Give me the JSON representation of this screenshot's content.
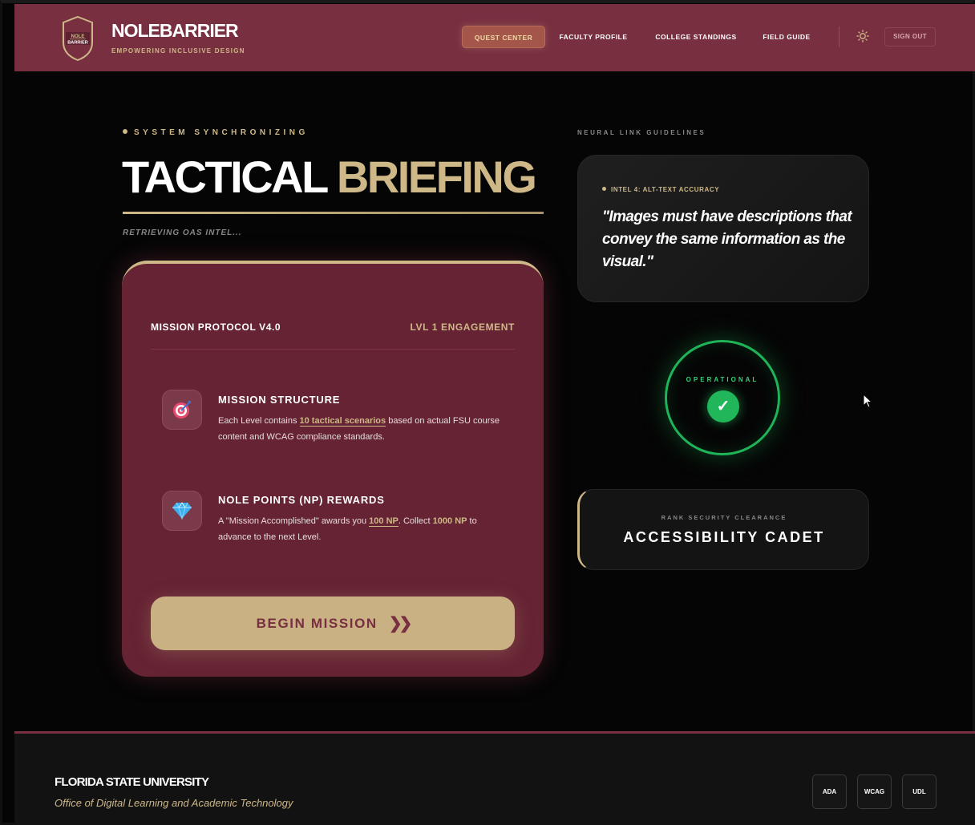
{
  "header": {
    "logo_lines": [
      "NOLE",
      "BARRIER"
    ],
    "title": "NOLEBARRIER",
    "subtitle": "EMPOWERING INCLUSIVE DESIGN",
    "nav": [
      {
        "label": "QUEST CENTER",
        "active": true
      },
      {
        "label": "FACULTY PROFILE",
        "active": false
      },
      {
        "label": "COLLEGE STANDINGS",
        "active": false
      },
      {
        "label": "FIELD GUIDE",
        "active": false
      }
    ],
    "theme_icon": "sun-icon",
    "signout_label": "SIGN OUT"
  },
  "main": {
    "status_line": "SYSTEM SYNCHRONIZING",
    "hero_word1": "TACTICAL",
    "hero_word2": "BRIEFING",
    "subtitle": "RETRIEVING OAS INTEL...",
    "card": {
      "protocol": "MISSION PROTOCOL V4.0",
      "level": "LVL 1 ENGAGEMENT",
      "features": [
        {
          "icon": "target-icon",
          "title": "MISSION STRUCTURE",
          "text_pre": "Each Level contains ",
          "text_hl": "10 tactical scenarios",
          "text_post": " based on actual FSU course content and WCAG compliance standards."
        },
        {
          "icon": "diamond-icon",
          "title": "NOLE POINTS (NP) REWARDS",
          "text_pre": "A \"Mission Accomplished\" awards you ",
          "text_hl": "100 NP",
          "text_mid": ". Collect ",
          "text_hl2": "1000 NP",
          "text_post": " to advance to the next Level."
        }
      ],
      "cta_label": "BEGIN MISSION",
      "cta_icon": "double-chevron-right-icon"
    }
  },
  "sidebar": {
    "heading": "NEURAL LINK GUIDELINES",
    "intel_tag": "INTEL 4: ALT-TEXT ACCURACY",
    "intel_quote": "\"Images must have descriptions that convey the same information as the visual.\"",
    "status_label": "OPERATIONAL",
    "status_icon": "checkmark-icon",
    "rank_label": "RANK SECURITY CLEARANCE",
    "rank_value": "ACCESSIBILITY CADET"
  },
  "footer": {
    "org": "FLORIDA STATE UNIVERSITY",
    "office": "Office of Digital Learning and Academic Technology",
    "badges": [
      "ADA",
      "WCAG",
      "UDL"
    ]
  },
  "colors": {
    "garnet": "#782f40",
    "gold": "#ceb888",
    "operational_green": "#21b65a",
    "background": "#050505"
  }
}
